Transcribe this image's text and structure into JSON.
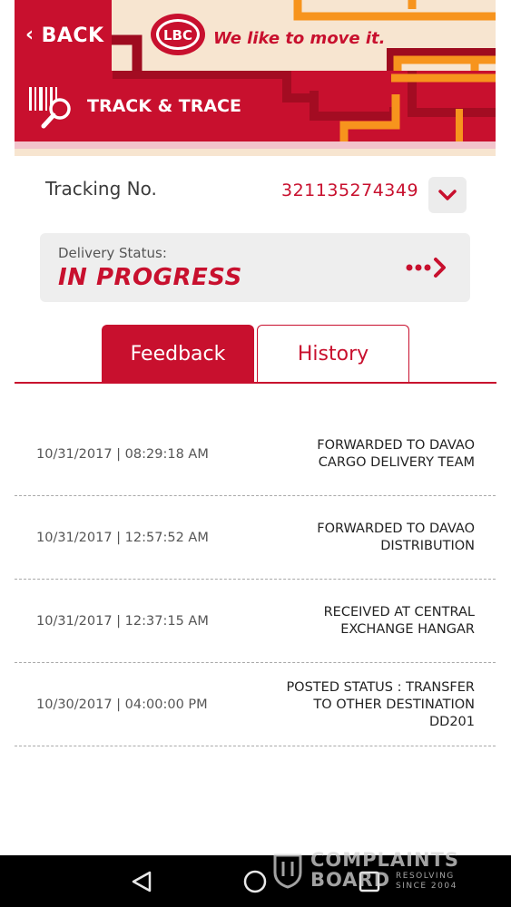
{
  "header": {
    "back_label": "BACK",
    "logo_text": "LBC",
    "tagline": "We like to move it.",
    "title": "TRACK & TRACE"
  },
  "tracking": {
    "label": "Tracking No.",
    "number": "321135274349"
  },
  "status": {
    "label": "Delivery Status:",
    "value": "IN PROGRESS"
  },
  "tabs": [
    {
      "label": "Feedback",
      "active": false
    },
    {
      "label": "History",
      "active": true
    }
  ],
  "history": [
    {
      "datetime": "10/31/2017 | 08:29:18 AM",
      "status_lines": [
        "FORWARDED TO DAVAO",
        "CARGO DELIVERY TEAM"
      ]
    },
    {
      "datetime": "10/31/2017 | 12:57:52 AM",
      "status_lines": [
        "FORWARDED TO DAVAO",
        "DISTRIBUTION"
      ]
    },
    {
      "datetime": "10/31/2017 | 12:37:15 AM",
      "status_lines": [
        "RECEIVED AT CENTRAL",
        "EXCHANGE HANGAR"
      ]
    },
    {
      "datetime": "10/30/2017 | 04:00:00 PM",
      "status_lines": [
        "POSTED STATUS : TRANSFER",
        "TO OTHER DESTINATION",
        "DD201"
      ]
    }
  ],
  "watermark": {
    "line1": "COMPLAINTS",
    "line2": "BOARD",
    "tag1": "RESOLVING",
    "tag2": "SINCE 2004"
  },
  "colors": {
    "brand_red": "#c8102e",
    "accent_orange": "#f7941d",
    "card_gray": "#eeeeee"
  },
  "icons": {
    "back": "chevron-left-icon",
    "track": "barcode-magnifier-icon",
    "dropdown": "chevron-down-icon",
    "status_more": "dots-chevron-right-icon",
    "nav": [
      "back-triangle-icon",
      "home-circle-icon",
      "recents-square-icon"
    ]
  }
}
